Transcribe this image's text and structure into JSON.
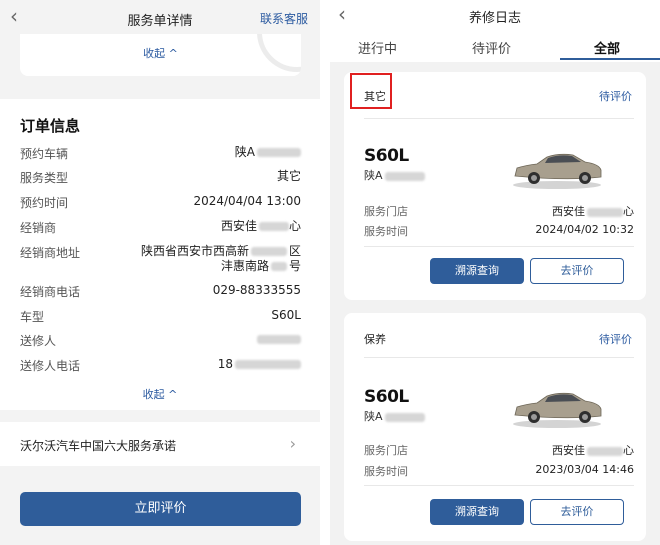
{
  "left": {
    "header": {
      "back_icon": "chevron-left-icon",
      "title": "服务单详情",
      "customer_service": "联系客服"
    },
    "top_card": {
      "collapse_label": "收起 ^"
    },
    "order_info": {
      "title": "订单信息",
      "rows": [
        {
          "key": "预约车辆",
          "value": "陕A"
        },
        {
          "key": "服务类型",
          "value": "其它"
        },
        {
          "key": "预约时间",
          "value": "2024/04/04 13:00"
        },
        {
          "key": "经销商",
          "value": "西安佳"
        },
        {
          "key": "经销商地址",
          "value": "陕西省西安市西高新",
          "value_suffix": "区",
          "value_line2": "沣惠南路",
          "value_line2_suffix": "号"
        },
        {
          "key": "经销商电话",
          "value": "029-88333555"
        },
        {
          "key": "车型",
          "value": "S60L"
        },
        {
          "key": "送修人",
          "value": ""
        },
        {
          "key": "送修人电话",
          "value": "18"
        }
      ],
      "collapse_label": "收起 ^"
    },
    "promise": {
      "text": "沃尔沃汽车中国六大服务承诺",
      "chevron_icon": "chevron-right-icon"
    },
    "rate_button": "立即评价"
  },
  "right": {
    "header": {
      "back_icon": "chevron-left-icon",
      "title": "养修日志"
    },
    "tabs": [
      {
        "label": "进行中",
        "active": false
      },
      {
        "label": "待评价",
        "active": false
      },
      {
        "label": "全部",
        "active": true
      }
    ],
    "records": [
      {
        "type": "其它",
        "status": "待评价",
        "model": "S60L",
        "plate": "陕A",
        "store_label": "服务门店",
        "store_value": "西安佳",
        "time_label": "服务时间",
        "time_value": "2024/04/02 10:32",
        "btn_trace": "溯源查询",
        "btn_rate": "去评价",
        "highlighted": true
      },
      {
        "type": "保养",
        "status": "待评价",
        "model": "S60L",
        "plate": "陕A",
        "store_label": "服务门店",
        "store_value": "西安佳",
        "time_label": "服务时间",
        "time_value": "2023/03/04 14:46",
        "btn_trace": "溯源查询",
        "btn_rate": "去评价",
        "highlighted": false
      }
    ]
  },
  "colors": {
    "accent": "#2f5d9a",
    "highlight_box": "#e02020"
  }
}
